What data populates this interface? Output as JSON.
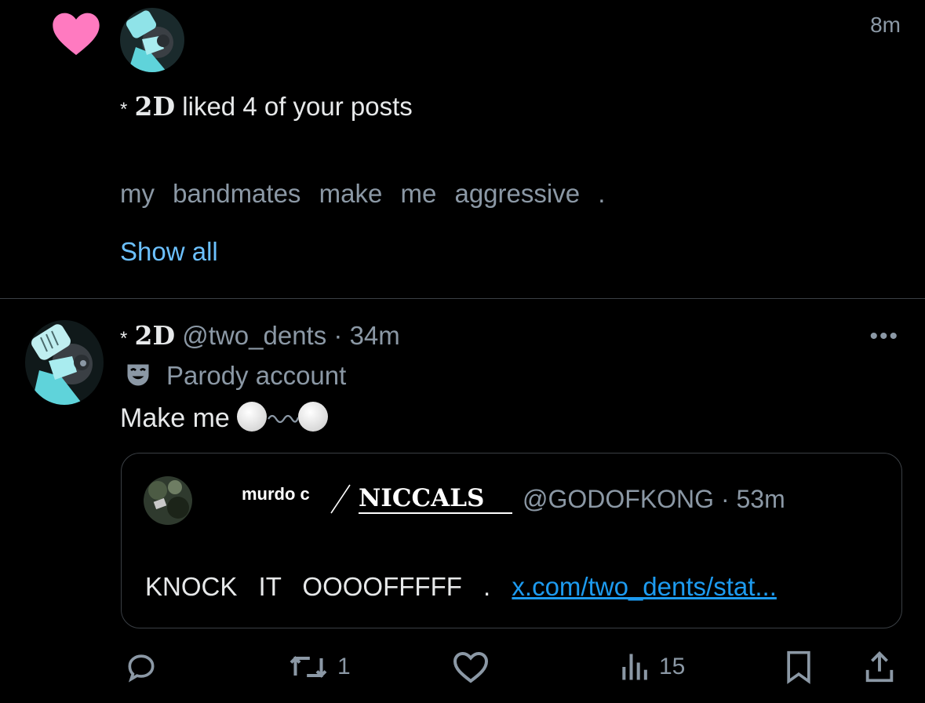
{
  "notification": {
    "time": "8m",
    "prefix": "*",
    "name": "2D",
    "action_text": " liked 4 of your posts",
    "preview": "my  bandmates  make  me  aggressive  .",
    "show_all": "Show all",
    "heart_color": "#ff7ac0"
  },
  "tweet": {
    "prefix": "*",
    "name": "2D",
    "handle": "@two_dents",
    "time": "34m",
    "label": "Parody account",
    "text": "Make me",
    "more": "•••"
  },
  "quote": {
    "name_small": "murdo c",
    "name": "NICCALS",
    "handle": "@GODOFKONG",
    "time": "53m",
    "text": "KNOCK   IT   OOOOFFFFF   .",
    "link": "x.com/two_dents/stat..."
  },
  "actions": {
    "retweets": "1",
    "views": "15"
  },
  "colors": {
    "background": "#000000",
    "link": "#1d9bf0",
    "show_all": "#6cc1ff",
    "muted": "#8b98a5"
  }
}
